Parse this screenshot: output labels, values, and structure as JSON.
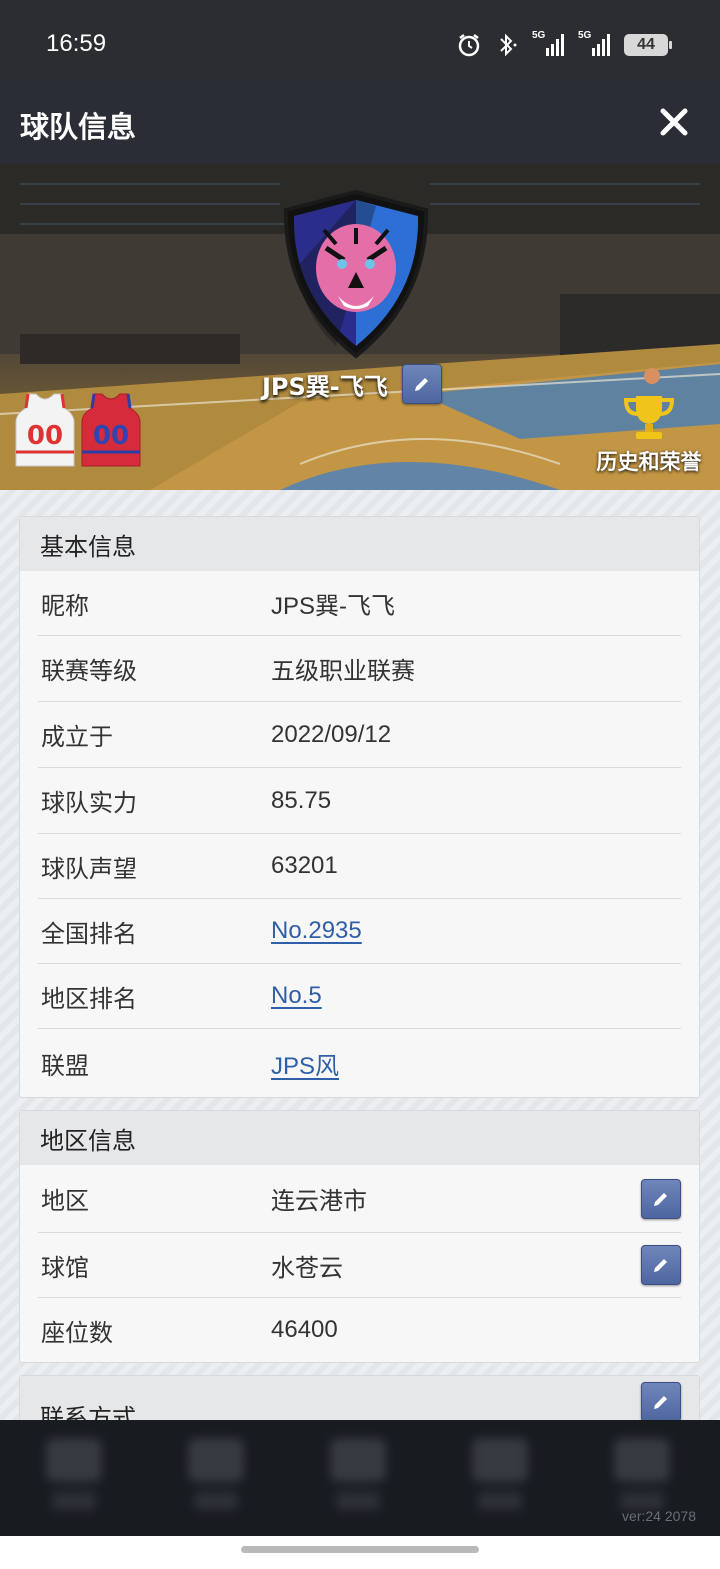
{
  "status_bar": {
    "time": "16:59",
    "network_1": "5G",
    "network_2": "5G",
    "battery": "44"
  },
  "header": {
    "title": "球队信息",
    "close_icon": "close-icon"
  },
  "banner": {
    "team_name": "JPS巽-飞飞",
    "honor_label": "历史和荣誉",
    "jersey_home_number": "00",
    "jersey_away_number": "00"
  },
  "basic_info": {
    "title": "基本信息",
    "rows": [
      {
        "label": "昵称",
        "value": "JPS巽-飞飞"
      },
      {
        "label": "联赛等级",
        "value": "五级职业联赛"
      },
      {
        "label": "成立于",
        "value": "2022/09/12"
      },
      {
        "label": "球队实力",
        "value": "85.75"
      },
      {
        "label": "球队声望",
        "value": "63201"
      },
      {
        "label": "全国排名",
        "value": "No.2935"
      },
      {
        "label": "地区排名",
        "value": "No.5"
      },
      {
        "label": "联盟",
        "value": "JPS风"
      }
    ]
  },
  "region_info": {
    "title": "地区信息",
    "rows": [
      {
        "label": "地区",
        "value": "连云港市"
      },
      {
        "label": "球馆",
        "value": "水苍云"
      },
      {
        "label": "座位数",
        "value": "46400"
      }
    ]
  },
  "contact": {
    "title": "联系方式"
  },
  "footer": {
    "version": "ver:24  2078"
  },
  "colors": {
    "header_bg": "#2a2d36",
    "link": "#2f5fa8",
    "edit_button": "#5b72aa"
  }
}
